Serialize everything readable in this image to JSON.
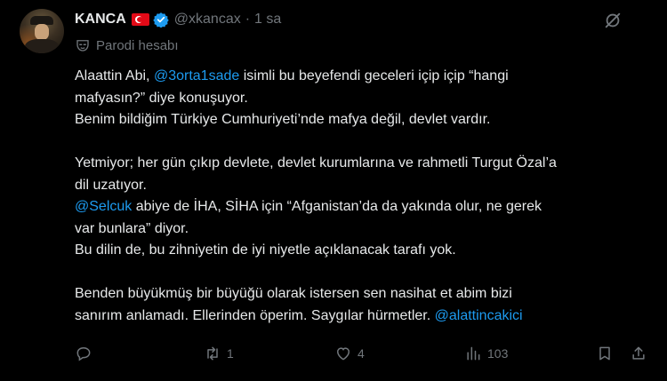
{
  "tweet": {
    "display_name": "KANCA",
    "handle": "@xkancax",
    "separator": "·",
    "time": "1 sa",
    "label": "Parodi hesabı",
    "lines": [
      [
        {
          "t": "Alaattin Abi, "
        },
        {
          "t": "@3orta1sade",
          "m": true
        },
        {
          "t": " isimli bu beyefendi geceleri içip içip “hangi"
        }
      ],
      [
        {
          "t": "mafyasın?” diye konuşuyor."
        }
      ],
      [
        {
          "t": "Benim bildiğim Türkiye Cumhuriyeti’nde mafya değil, devlet vardır."
        }
      ],
      [],
      [
        {
          "t": "Yetmiyor; her gün çıkıp devlete, devlet kurumlarına ve rahmetli Turgut Özal’a"
        }
      ],
      [
        {
          "t": "dil uzatıyor."
        }
      ],
      [
        {
          "t": "@Selcuk",
          "m": true
        },
        {
          "t": " abiye de İHA, SİHA için “Afganistan’da da yakında olur, ne gerek"
        }
      ],
      [
        {
          "t": "var bunlara” diyor."
        }
      ],
      [
        {
          "t": "Bu dilin de, bu zihniyetin de iyi niyetle açıklanacak tarafı yok."
        }
      ],
      [],
      [
        {
          "t": "Benden büyükmüş bir büyüğü olarak istersen sen nasihat et abim bizi"
        }
      ],
      [
        {
          "t": "sanırım anlamadı. Ellerinden öperim. Saygılar hürmetler. "
        },
        {
          "t": "@alattincakici",
          "m": true
        }
      ]
    ],
    "stats": {
      "reposts": "1",
      "likes": "4",
      "views": "103"
    },
    "colors": {
      "background": "#000000",
      "text": "#e7e9ea",
      "muted": "#71767b",
      "link": "#1d9bf0",
      "verified": "#1d9bf0",
      "flag": "#e30a17"
    },
    "icons": [
      "flag-tr-icon",
      "verified-icon",
      "grok-slash-icon",
      "mask-icon",
      "reply-icon",
      "repost-icon",
      "like-icon",
      "views-icon",
      "bookmark-icon",
      "share-icon"
    ]
  }
}
